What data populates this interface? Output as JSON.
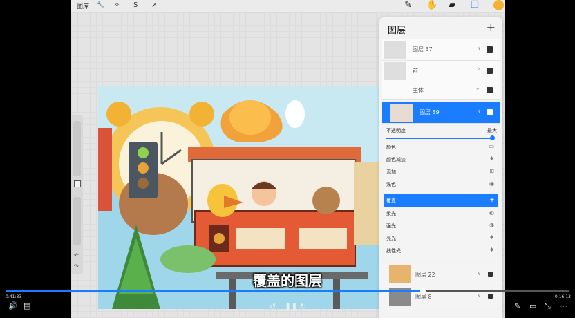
{
  "toolbar": {
    "gallery_label": "图库",
    "left_tools": [
      "wrench-icon",
      "magic-wand-icon",
      "selection-s-icon",
      "move-arrow-icon"
    ],
    "right_tools": [
      "brush-icon",
      "smudge-icon",
      "eraser-icon",
      "layers-icon",
      "color-swatch"
    ],
    "active_tool": "layers-icon",
    "current_color": "#f2b233"
  },
  "layers_panel": {
    "title": "图层",
    "add_symbol": "+",
    "layers": [
      {
        "name": "图层 37",
        "mode": "N",
        "visible": true
      },
      {
        "name": "前",
        "group": true,
        "visible": true
      },
      {
        "name": "主体",
        "group": true,
        "expanded": true,
        "visible": true
      },
      {
        "name": "图层 39",
        "mode": "N",
        "visible": true,
        "selected": true
      }
    ],
    "opacity_label": "不透明度",
    "opacity_value": "最大",
    "opacity_fraction": 1.0,
    "blend_modes": [
      "颜色",
      "颜色减淡",
      "添加",
      "浅色",
      "覆盖",
      "柔光",
      "强光",
      "亮光",
      "线性光"
    ],
    "selected_blend_mode": "覆盖",
    "lower_layers": [
      {
        "name": "图层 22",
        "mode": "N",
        "visible": true
      },
      {
        "name": "图层 8",
        "mode": "N",
        "visible": true
      }
    ]
  },
  "video": {
    "subtitle": "覆盖的图层",
    "elapsed": "0:41:33",
    "duration": "0:16:13",
    "progress_fraction": 0.74,
    "accent_color": "#1a7cff"
  }
}
